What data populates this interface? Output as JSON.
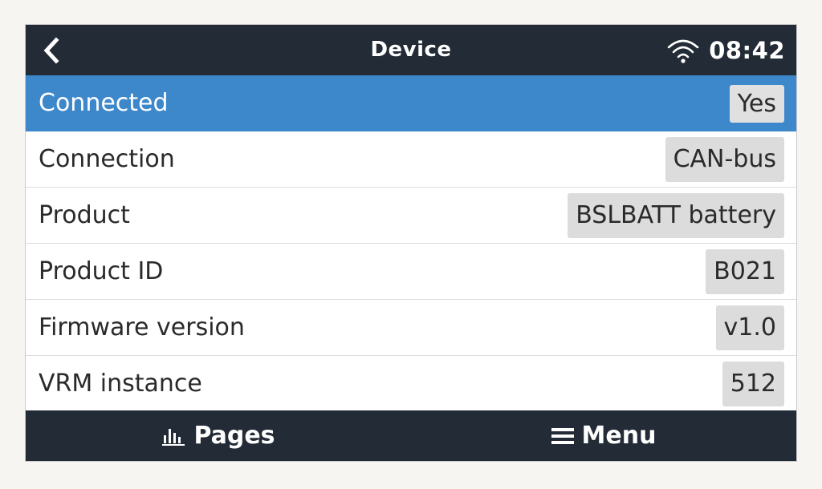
{
  "header": {
    "title": "Device",
    "time": "08:42",
    "back_icon": "chevron-left-icon",
    "wifi_icon": "wifi-icon"
  },
  "rows": [
    {
      "label": "Connected",
      "value": "Yes",
      "selected": true
    },
    {
      "label": "Connection",
      "value": "CAN-bus",
      "selected": false
    },
    {
      "label": "Product",
      "value": "BSLBATT battery",
      "selected": false
    },
    {
      "label": "Product ID",
      "value": "B021",
      "selected": false
    },
    {
      "label": "Firmware version",
      "value": "v1.0",
      "selected": false
    },
    {
      "label": "VRM instance",
      "value": "512",
      "selected": false
    }
  ],
  "footer": {
    "pages_label": "Pages",
    "menu_label": "Menu",
    "pages_icon": "bar-chart-icon",
    "menu_icon": "hamburger-menu-icon"
  },
  "colors": {
    "header_bg": "#222b36",
    "selected_row": "#3d87cb",
    "value_chip": "#dcdcdc"
  }
}
